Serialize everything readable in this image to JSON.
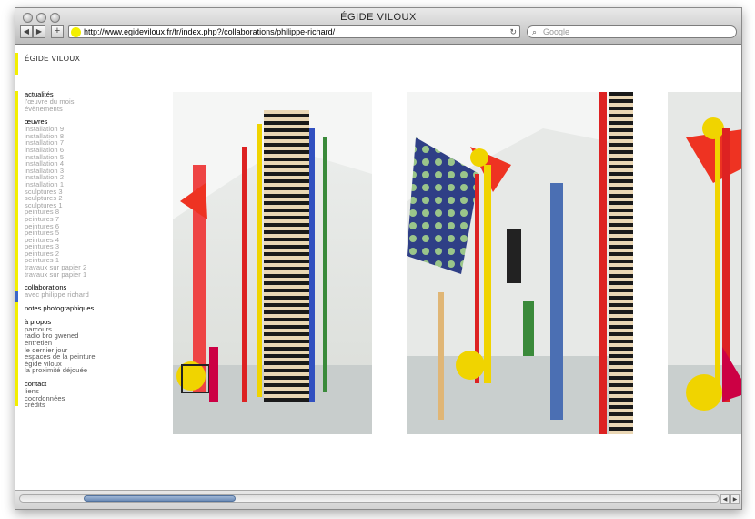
{
  "window": {
    "title": "ÉGIDE VILOUX"
  },
  "toolbar": {
    "back_icon": "back-arrow-icon",
    "forward_icon": "forward-arrow-icon",
    "add_icon": "plus-icon",
    "url": "http://www.egideviloux.fr/fr/index.php?/collaborations/philippe-richard/",
    "reload_icon": "reload-icon",
    "search_placeholder": "Google"
  },
  "site": {
    "title": "ÉGIDE VILOUX"
  },
  "sidebar": {
    "sections": [
      {
        "head": "actualités",
        "items": [
          "l'œuvre du mois",
          "évènements"
        ]
      },
      {
        "head": "œuvres",
        "items": [
          "installation 9",
          "installation 8",
          "installation 7",
          "installation 6",
          "installation 5",
          "installation 4",
          "installation 3",
          "installation 2",
          "installation 1",
          "sculptures 3",
          "sculptures 2",
          "sculptures 1",
          "peintures 8",
          "peintures 7",
          "peintures 6",
          "peintures 5",
          "peintures 4",
          "peintures 3",
          "peintures 2",
          "peintures 1",
          "travaux sur papier 2",
          "travaux sur papier 1"
        ]
      },
      {
        "head": "collaborations",
        "items": [
          "avec philippe richard"
        ]
      },
      {
        "head": "notes photographiques",
        "items": []
      },
      {
        "head": "à propos",
        "items": [
          "parcours",
          "radio bro gwened",
          "entretien",
          "le dernier jour",
          "espaces de la peinture",
          "égide viloux",
          "la proximité déjouée"
        ]
      },
      {
        "head": "contact",
        "items": [
          "liens",
          "coordonnées",
          "crédits"
        ]
      }
    ]
  },
  "colors": {
    "accent_yellow": "#f3ef00",
    "accent_blue": "#3c66c8"
  }
}
